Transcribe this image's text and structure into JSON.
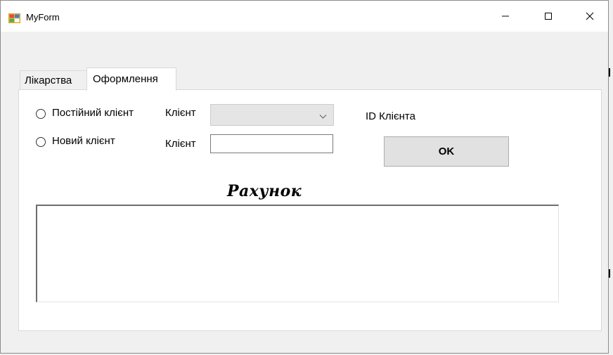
{
  "window": {
    "title": "MyForm"
  },
  "tabs": [
    {
      "label": "Лікарства",
      "active": false
    },
    {
      "label": "Оформлення",
      "active": true
    }
  ],
  "form": {
    "regular_client_label": "Постійний клієнт",
    "new_client_label": "Новий клієнт",
    "client_label_1": "Клієнт",
    "client_label_2": "Клієнт",
    "client_combo_value": "",
    "client_input_value": "",
    "client_id_label": "ID Клієнта",
    "ok_label": "OK",
    "bill_heading": "Рахунок",
    "bill_text": ""
  },
  "icons": {
    "app": "windows-form-icon",
    "minimize": "minimize-icon",
    "maximize": "maximize-icon",
    "close": "close-icon",
    "dropdown": "chevron-down-icon"
  }
}
